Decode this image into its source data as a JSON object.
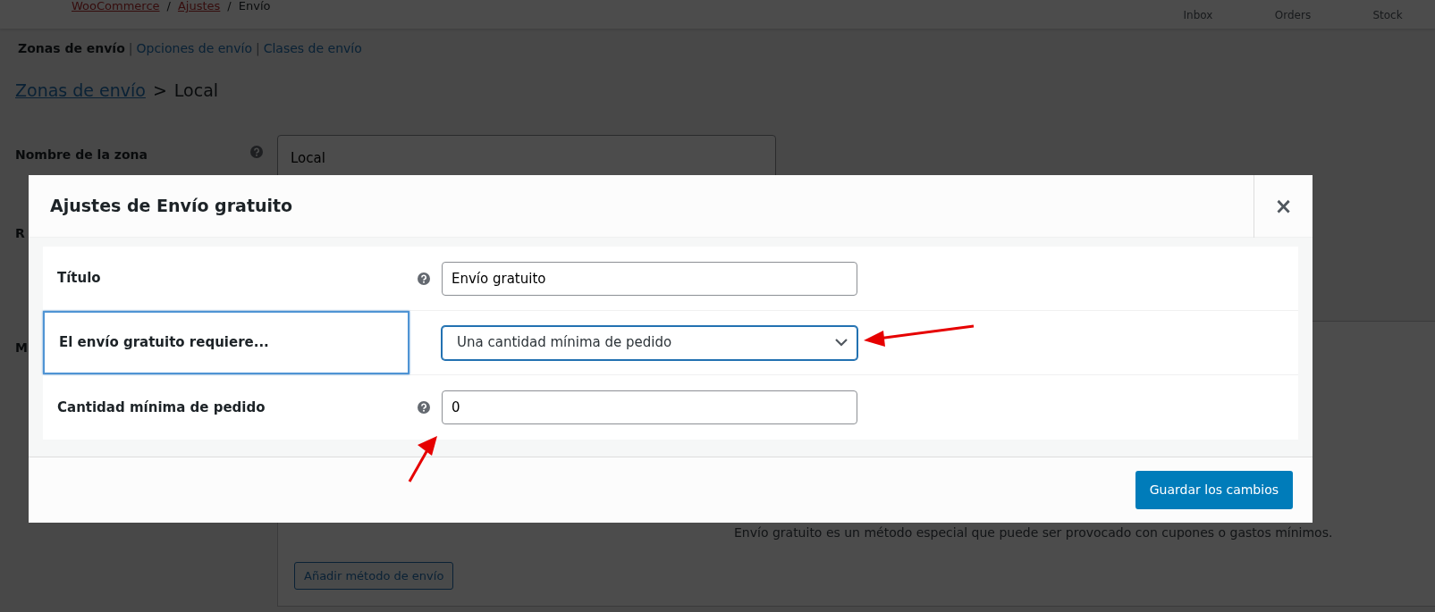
{
  "admin_bar": {
    "breadcrumb": [
      {
        "label": "WooCommerce",
        "link": true
      },
      {
        "separator": "/",
        "label": "Ajustes",
        "link": true
      },
      {
        "separator": "/",
        "label": "Envío",
        "link": false
      }
    ],
    "activity": [
      {
        "label": "Inbox"
      },
      {
        "label": "Orders"
      },
      {
        "label": "Stock"
      }
    ]
  },
  "subtabs": [
    {
      "label": "Zonas de envío",
      "selected": true
    },
    {
      "separator": "|",
      "label": "Opciones de envío",
      "selected": false
    },
    {
      "separator": "|",
      "label": "Clases de envío",
      "selected": false
    }
  ],
  "heading": {
    "link": "Zonas de envío",
    "separator": ">",
    "current": "Local"
  },
  "zone_form": {
    "fields": [
      {
        "label": "Nombre de la zona",
        "help": true,
        "value": "Local"
      },
      {
        "label": "R",
        "help": false
      },
      {
        "label": "M",
        "help": false
      }
    ]
  },
  "methods_panel": {
    "description": "Envío gratuito es un método especial que puede ser provocado con cupones o gastos mínimos.",
    "add_button": "Añadir método de envío"
  },
  "modal": {
    "title": "Ajustes de Envío gratuito",
    "close": "×",
    "fields": [
      {
        "kind": "text",
        "label": "Título",
        "help": true,
        "value": "Envío gratuito",
        "highlighted": false
      },
      {
        "kind": "select",
        "label": "El envío gratuito requiere...",
        "help": false,
        "value": "Una cantidad mínima de pedido",
        "highlighted": true
      },
      {
        "kind": "text",
        "label": "Cantidad mínima de pedido",
        "help": true,
        "value": "0",
        "highlighted": false
      }
    ],
    "save_button": "Guardar los cambios"
  }
}
